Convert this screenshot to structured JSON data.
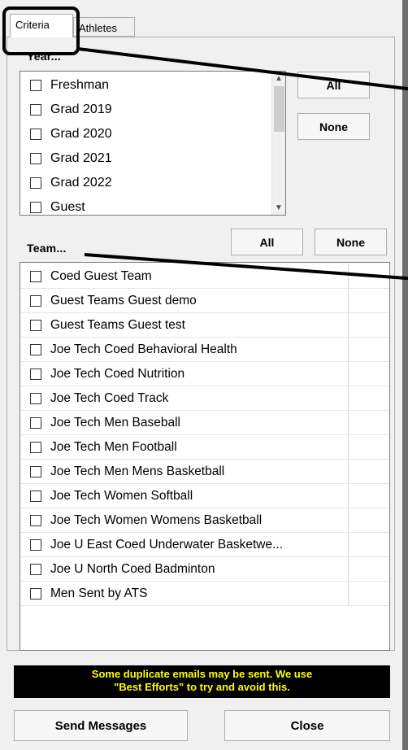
{
  "tabs": [
    {
      "label": "Criteria"
    },
    {
      "label": "Athletes"
    }
  ],
  "year": {
    "title": "Year...",
    "items": [
      "Freshman",
      "Grad 2019",
      "Grad 2020",
      "Grad 2021",
      "Grad 2022",
      "Guest"
    ],
    "all_label": "All",
    "none_label": "None"
  },
  "team": {
    "title": "Team...",
    "all_label": "All",
    "none_label": "None",
    "items": [
      "Coed Guest Team",
      "Guest Teams Guest demo",
      "Guest Teams Guest test",
      "Joe Tech Coed Behavioral Health",
      "Joe Tech Coed Nutrition",
      "Joe Tech Coed Track",
      "Joe Tech Men Baseball",
      "Joe Tech Men Football",
      "Joe Tech Men Mens Basketball",
      "Joe Tech Women Softball",
      "Joe Tech Women Womens Basketball",
      "Joe U East Coed Underwater Basketwe...",
      "Joe U North Coed Badminton",
      "Men Sent by ATS"
    ]
  },
  "warning": {
    "line1": "Some duplicate emails may be sent.  We use",
    "line2": "\"Best Efforts\" to try and avoid this."
  },
  "buttons": {
    "send": "Send Messages",
    "close": "Close"
  },
  "colors": {
    "warning_bg": "#000000",
    "warning_text": "#ffff00"
  }
}
